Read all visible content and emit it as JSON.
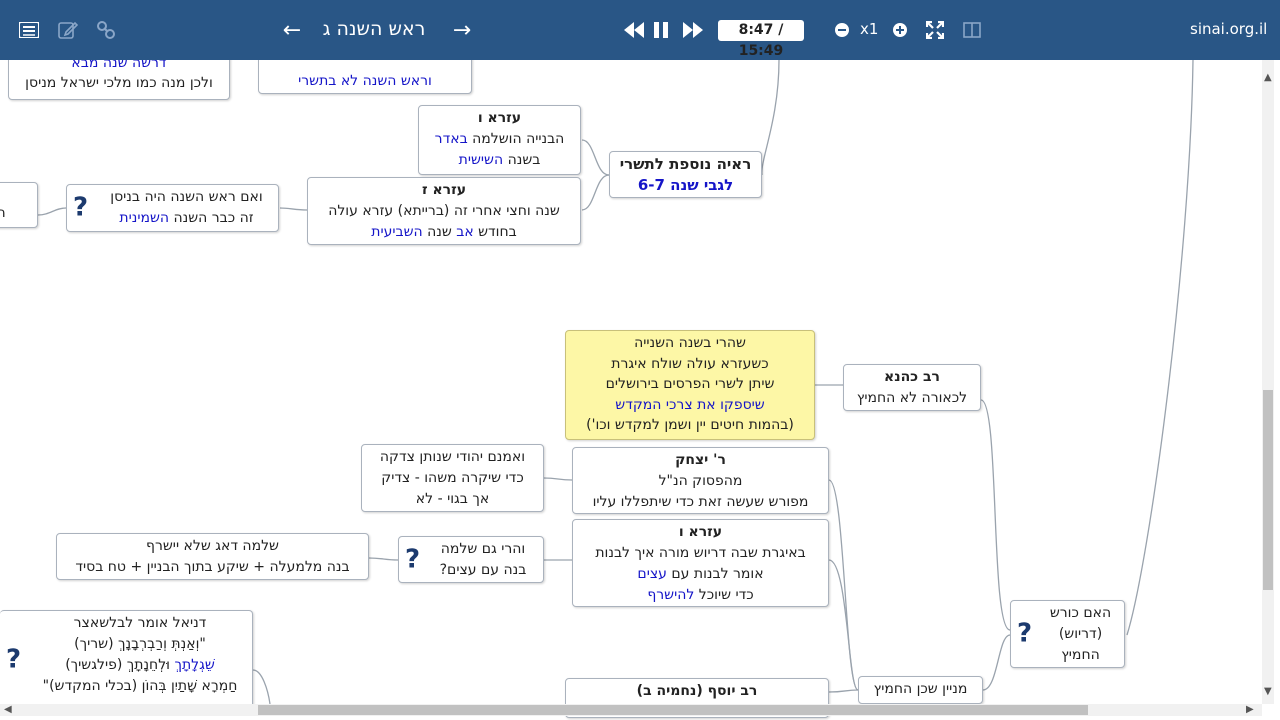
{
  "toolbar": {
    "title": "ראש השנה ג",
    "prev_arrow": "←",
    "next_arrow": "→",
    "time": "8:47 / 15:49",
    "zoom": "x1",
    "site": "sinai.org.il",
    "icons": [
      "menu-icon",
      "edit-icon",
      "link-icon",
      "rewind-icon",
      "pause-icon",
      "fast-forward-icon",
      "zoom-out-icon",
      "zoom-in-icon",
      "fullscreen-icon",
      "split-view-icon"
    ]
  },
  "nodes": {
    "top_left": {
      "line1": "דרשה שנה מבא",
      "line2": "ולכן מנה כמו מלכי ישראל מניסן"
    },
    "top_mid": {
      "line1": "וראש השנה לא בתשרי"
    },
    "ezra6": {
      "title": "עזרא ו",
      "line1": "הבנייה הושלמה",
      "line1_blue": "באדר",
      "line2": "בשנה",
      "line2_blue": "השישית"
    },
    "raya": {
      "title": "ראיה נוספת לתשרי",
      "line1": "לגבי שנה 6-7"
    },
    "ezra7": {
      "title": "עזרא ז",
      "line1": "שנה וחצי אחרי זה (ברייתא) עזרא עולה",
      "line2_pre": "בחודש",
      "line2_blue1": "אב",
      "line2_mid": "שנה",
      "line2_blue2": "השביעית"
    },
    "nisan": {
      "line1": "ואם ראש השנה היה בניסן",
      "line2": "זה כבר השנה",
      "line2_blue": "השמינית"
    },
    "edge_left": {
      "line1": "המ"
    },
    "yellow": {
      "line1": "שהרי בשנה השנייה",
      "line2": "כשעזרא עולה שולח איגרת",
      "line3": "שיתן לשרי הפרסים בירושלים",
      "line4": "שיספקו את צרכי המקדש",
      "line5": "(בהמות חיטים יין ושמן למקדש וכו')"
    },
    "rav_kahana": {
      "title": "רב כהנא",
      "line1": "לכאורה לא החמיץ"
    },
    "r_yitzchak": {
      "title": "ר' יצחק",
      "line1": "מהפסוק הנ\"ל",
      "line2": "מפורש שעשה זאת כדי שיתפללו עליו"
    },
    "tzedaka": {
      "line1": "ואמנם יהודי שנותן צדקה",
      "line2": "כדי שיקרה משהו -  צדיק",
      "line3": "אך בגוי - לא"
    },
    "ezra6b": {
      "title": "עזרא ו",
      "line1": "באיגרת שבה דריוש מורה איך לבנות",
      "line2": "אומר לבנות עם",
      "line2_blue": "עצים",
      "line3": "כדי שיוכל",
      "line3_blue": "להישרף"
    },
    "shlomo": {
      "line1": "והרי גם שלמה",
      "line2": "בנה עם עצים?"
    },
    "shlomo_daag": {
      "line1": "שלמה דאג שלא יישרף",
      "line2": "בנה מלמעלה + שיקע בתוך הבניין + טח בסיד"
    },
    "daniel": {
      "line1": "דניאל אומר לבלשאצר",
      "line2": "\"וְאַנְתְּ וְרַבְרְבָנָךְ (שריך)",
      "line3_blue": "שֵׁגְלָתָךְ",
      "line3": "וּלְחֵנָתָךְ (פילגשיך)",
      "line4": "חַמְרָא שָׁתַיִן בְּהוֹן (בכלי המקדש)\""
    },
    "koresh": {
      "line1": "האם כורש",
      "line2": "(דריוש)",
      "line3": "החמיץ"
    },
    "minayin": {
      "line1": "מניין שכן החמיץ"
    },
    "rav_yosef": {
      "title": "רב יוסף (נחמיה ב)"
    }
  }
}
